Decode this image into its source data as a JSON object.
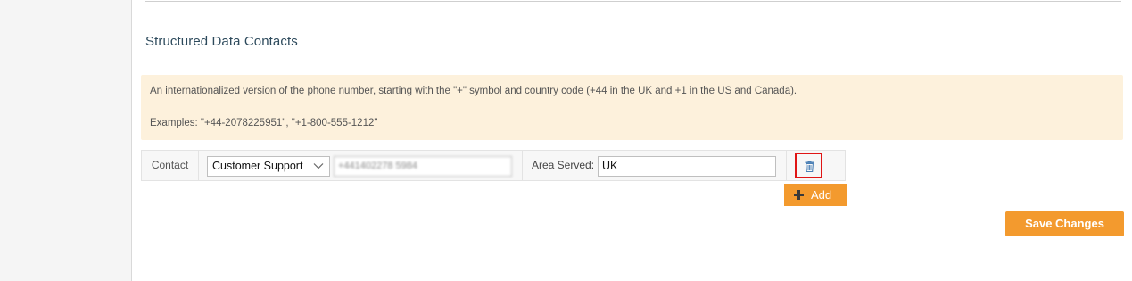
{
  "section": {
    "title": "Structured Data Contacts"
  },
  "notice": {
    "line1": "An internationalized version of the phone number, starting with the \"+\" symbol and country code (+44 in the UK and +1 in the US and Canada).",
    "line2": "Examples: \"+44-2078225951\", \"+1-800-555-1212\""
  },
  "contact": {
    "label": "Contact",
    "type_value": "Customer Support",
    "phone_value": "+441402278 5984",
    "area_label": "Area Served:",
    "area_value": "UK"
  },
  "actions": {
    "add_label": "Add",
    "save_label": "Save Changes"
  },
  "colors": {
    "accent": "#f39a2e",
    "notice_bg": "#fdf1dc",
    "highlight": "#e01515",
    "trash": "#4a7fb5"
  },
  "icons": {
    "delete": "trash-icon",
    "add": "plus-icon",
    "select": "chevron-down-icon"
  }
}
